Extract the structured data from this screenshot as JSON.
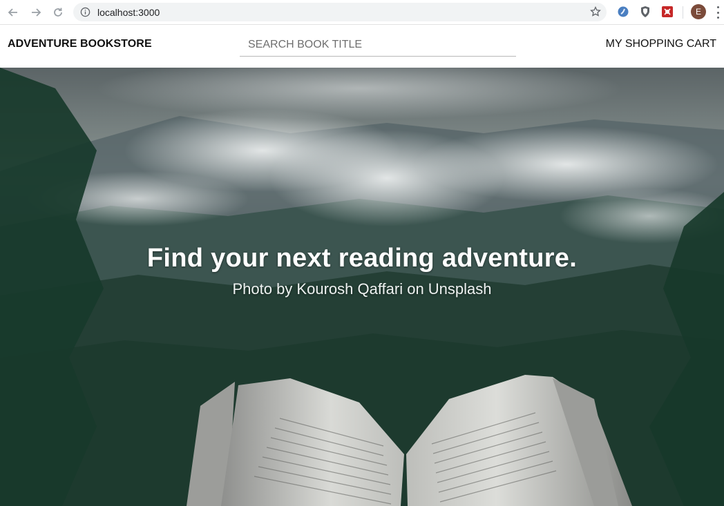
{
  "browser": {
    "url": "localhost:3000",
    "profile_initial": "E"
  },
  "header": {
    "brand": "ADVENTURE BOOKSTORE",
    "search_placeholder": "SEARCH BOOK TITLE",
    "cart_label": "MY SHOPPING CART"
  },
  "hero": {
    "title": "Find your next reading adventure.",
    "subtitle": "Photo by Kourosh Qaffari on Unsplash"
  }
}
